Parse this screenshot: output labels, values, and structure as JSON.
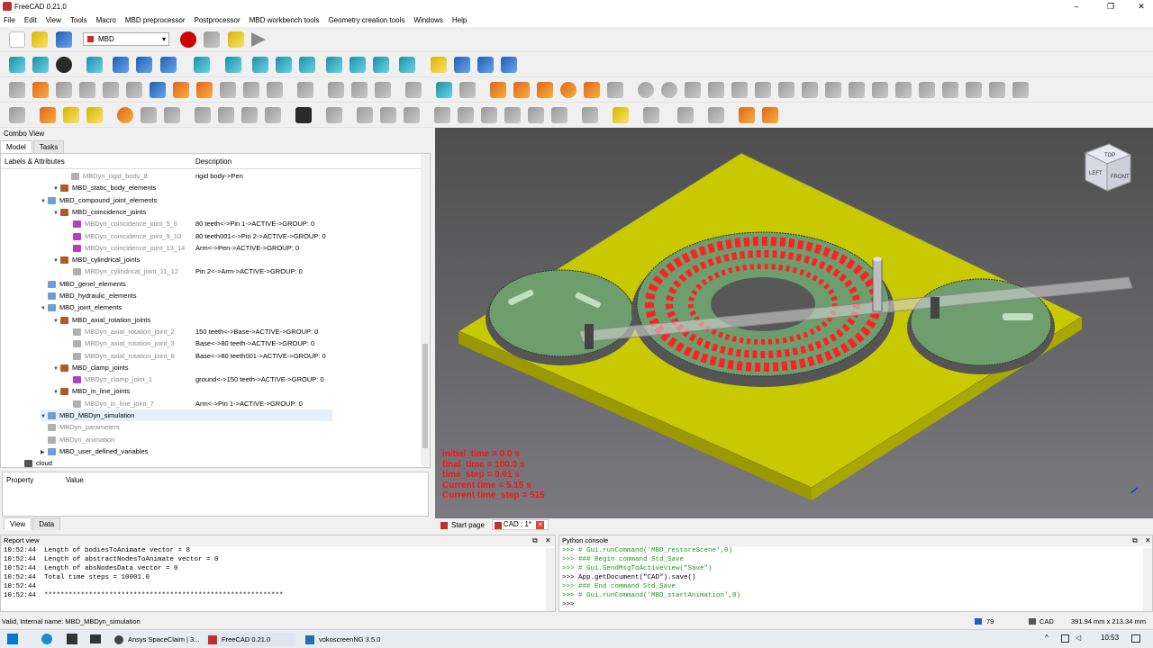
{
  "window": {
    "title": "FreeCAD 0.21.0"
  },
  "menu": [
    "File",
    "Edit",
    "View",
    "Tools",
    "Macro",
    "MBD preprocessor",
    "Postprocessor",
    "MBD workbench tools",
    "Geometry creation tools",
    "Windows",
    "Help"
  ],
  "toolbar": {
    "workbench": "MBD"
  },
  "combo": {
    "title": "Combo View",
    "tabs": [
      "Model",
      "Tasks"
    ],
    "col_labels": "Labels & Attributes",
    "col_desc": "Description"
  },
  "tree": [
    {
      "label": "MBDyn_rigid_body_8",
      "desc": "rigid body->Pen",
      "gray": true
    },
    {
      "label": "MBD_static_body_elements",
      "desc": ""
    },
    {
      "label": "MBD_compound_joint_elements",
      "desc": ""
    },
    {
      "label": "MBD_coincidence_joints",
      "desc": ""
    },
    {
      "label": "MBDyn_coincidence_joint_5_6",
      "desc": "80 teeth<->Pin 1->ACTIVE->GROUP: 0",
      "gray": true
    },
    {
      "label": "MBDyn_coincidence_joint_9_10",
      "desc": "80 teeth001<->Pin 2->ACTIVE->GROUP: 0",
      "gray": true
    },
    {
      "label": "MBDyn_coincidence_joint_13_14",
      "desc": "Arm<->Pen->ACTIVE->GROUP: 0",
      "gray": true
    },
    {
      "label": "MBD_cylindrical_joints",
      "desc": ""
    },
    {
      "label": "MBDyn_cylindrical_joint_11_12",
      "desc": "Pin 2<->Arm->ACTIVE->GROUP: 0",
      "gray": true
    },
    {
      "label": "MBD_genel_elements",
      "desc": ""
    },
    {
      "label": "MBD_hydraulic_elements",
      "desc": ""
    },
    {
      "label": "MBD_joint_elements",
      "desc": ""
    },
    {
      "label": "MBD_axial_rotation_joints",
      "desc": ""
    },
    {
      "label": "MBDyn_axial_rotation_joint_2",
      "desc": "150 teeth<->Base->ACTIVE->GROUP: 0",
      "gray": true
    },
    {
      "label": "MBDyn_axial_rotation_joint_3",
      "desc": "Base<->80 teeth->ACTIVE->GROUP: 0",
      "gray": true
    },
    {
      "label": "MBDyn_axial_rotation_joint_8",
      "desc": "Base<->80 teeth001->ACTIVE->GROUP: 0",
      "gray": true
    },
    {
      "label": "MBD_clamp_joints",
      "desc": ""
    },
    {
      "label": "MBDyn_clamp_joint_1",
      "desc": "ground<->150 teeth->ACTIVE->GROUP: 0",
      "gray": true
    },
    {
      "label": "MBD_in_line_joints",
      "desc": ""
    },
    {
      "label": "MBDyn_in_line_joint_7",
      "desc": "Arm<->Pin 1->ACTIVE->GROUP: 0",
      "gray": true
    },
    {
      "label": "MBD_MBDyn_simulation",
      "desc": "",
      "selected": true
    },
    {
      "label": "MBDyn_parameters",
      "desc": "",
      "gray": true
    },
    {
      "label": "MBDyn_animation",
      "desc": "",
      "gray": true
    },
    {
      "label": "MBD_user_defined_variables",
      "desc": ""
    },
    {
      "label": "cloud",
      "desc": ""
    }
  ],
  "property": {
    "col1": "Property",
    "col2": "Value",
    "tabs": [
      "View",
      "Data"
    ]
  },
  "viewport": {
    "overlay": [
      "initial_time = 0.0 s",
      "final_time = 100.0 s",
      "time_step = 0.01 s",
      "Current time = 5.15 s",
      "Current time_step = 515"
    ],
    "navcube": {
      "top": "TOP",
      "left": "LEFT",
      "front": "FRONT"
    }
  },
  "doctabs": [
    "Start page",
    "CAD : 1*"
  ],
  "report": {
    "title": "Report view",
    "lines": [
      "10:52:44  Length of bodiesToAnimate vector = 8",
      "10:52:44  Length of abstractNodesToAnimate vector = 0",
      "10:52:44  Length of absNodesData vector = 0",
      "10:52:44  Total time steps = 10001.0",
      "10:52:44",
      "10:52:44  ***********************************************************"
    ]
  },
  "python": {
    "title": "Python console",
    "lines": [
      ">>> # Gui.runCommand('MBD_restoreScene',0)",
      ">>> ### Begin command Std_Save",
      ">>> # Gui.SendMsgToActiveView(\"Save\")",
      ">>> App.getDocument(\"CAD\").save()",
      ">>> ### End command Std_Save",
      ">>> # Gui.runCommand('MBD_startAnimation',0)",
      ">>>"
    ]
  },
  "status": {
    "text": "Valid, Internal name: MBD_MBDyn_simulation",
    "count": "79",
    "nav": "CAD",
    "dims": "391.94 mm x 213.34 mm"
  },
  "taskbar": {
    "apps": [
      "Ansys SpaceClaim | 3...",
      "FreeCAD 0.21.0",
      "vokoscreenNG 3.5.0"
    ],
    "clock": "10:53"
  },
  "colors": {
    "base": "#c8c800",
    "gear": "#6e9d6e",
    "trace": "#ff2020"
  }
}
